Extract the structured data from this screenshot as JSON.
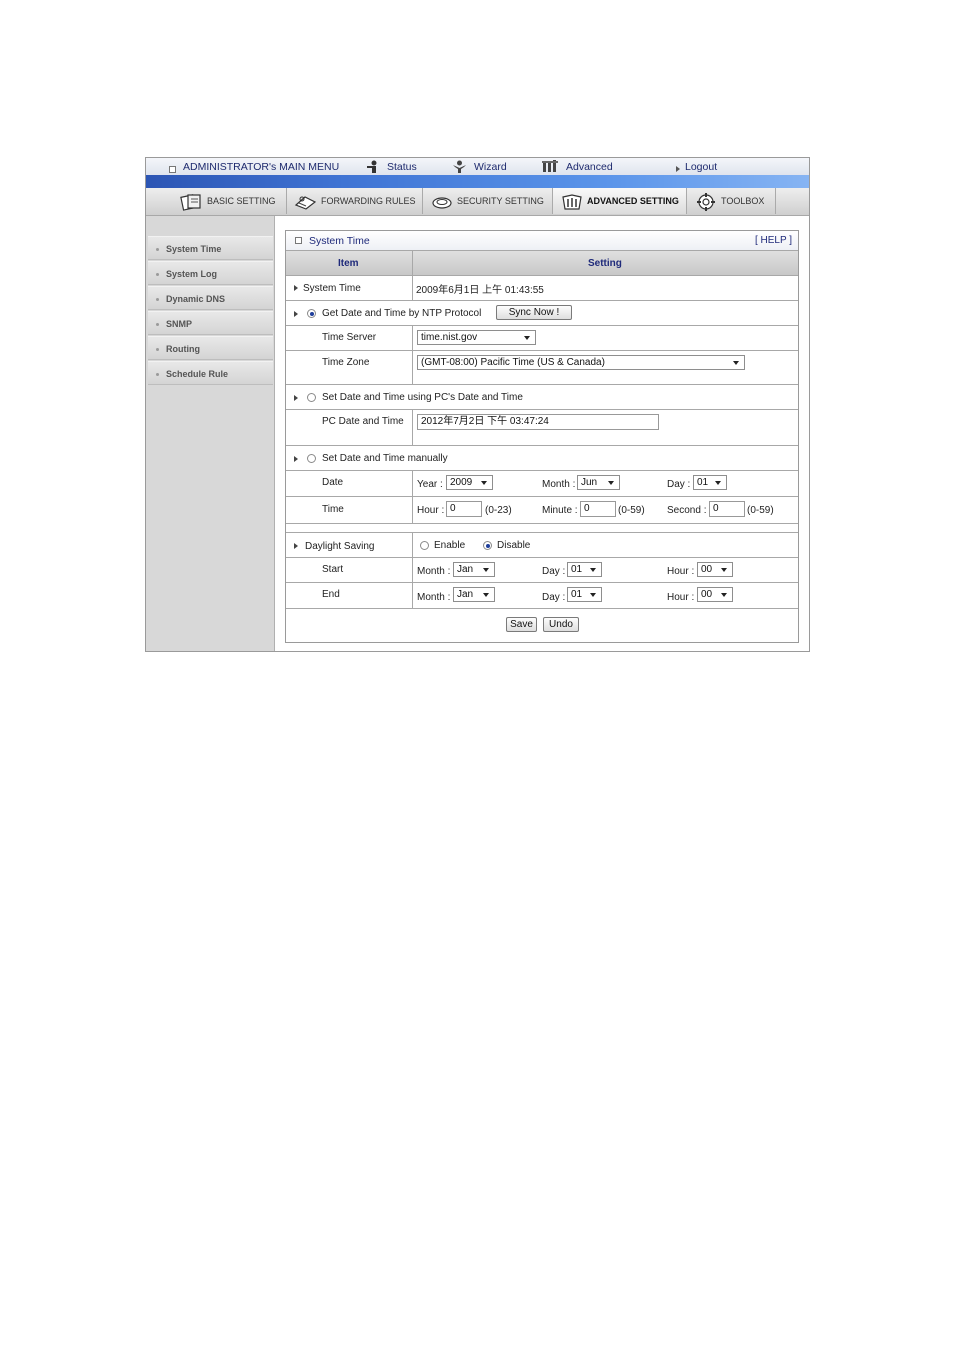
{
  "main_menu": {
    "title": "ADMINISTRATOR's MAIN MENU",
    "status": "Status",
    "wizard": "Wizard",
    "advanced": "Advanced",
    "logout": "Logout"
  },
  "tabs": [
    "BASIC SETTING",
    "FORWARDING RULES",
    "SECURITY SETTING",
    "ADVANCED SETTING",
    "TOOLBOX"
  ],
  "active_tab": "ADVANCED SETTING",
  "sidebar": [
    "System Time",
    "System Log",
    "Dynamic DNS",
    "SNMP",
    "Routing",
    "Schedule Rule"
  ],
  "panel": {
    "title": "System Time",
    "help": "[ HELP ]",
    "col_item": "Item",
    "col_setting": "Setting"
  },
  "system_time": {
    "label": "System Time",
    "value": "2009年6月1日 上午 01:43:55"
  },
  "ntp": {
    "label": "Get Date and Time by NTP Protocol",
    "sync_button": "Sync Now !",
    "server_label": "Time Server",
    "server_value": "time.nist.gov",
    "zone_label": "Time Zone",
    "zone_value": "(GMT-08:00) Pacific Time (US & Canada)"
  },
  "pc": {
    "label": "Set Date and Time using PC's Date and Time",
    "time_label": "PC Date and Time",
    "time_value": "2012年7月2日 下午 03:47:24"
  },
  "manual": {
    "label": "Set Date and Time manually",
    "date_label": "Date",
    "year_label": "Year :",
    "year_value": "2009",
    "month_label": "Month :",
    "month_value": "Jun",
    "day_label": "Day :",
    "day_value": "01",
    "time_label": "Time",
    "hour_label": "Hour :",
    "hour_value": "0",
    "hour_range": "(0-23)",
    "minute_label": "Minute :",
    "minute_value": "0",
    "minute_range": "(0-59)",
    "second_label": "Second :",
    "second_value": "0",
    "second_range": "(0-59)"
  },
  "dst": {
    "label": "Daylight Saving",
    "enable": "Enable",
    "disable": "Disable",
    "selected": "Disable",
    "start_label": "Start",
    "end_label": "End",
    "month_label": "Month :",
    "day_label": "Day :",
    "hour_label": "Hour :",
    "start_month": "Jan",
    "start_day": "01",
    "start_hour": "00",
    "end_month": "Jan",
    "end_day": "01",
    "end_hour": "00"
  },
  "buttons": {
    "save": "Save",
    "undo": "Undo"
  },
  "colors": {
    "accent_blue": "#3f74d4",
    "menu_text": "#1e2a6e",
    "title_text": "#1f2a7a"
  }
}
